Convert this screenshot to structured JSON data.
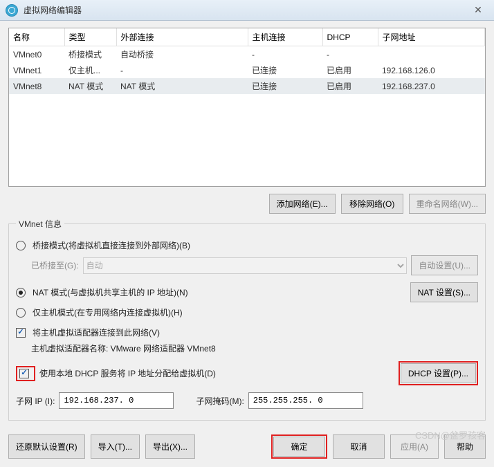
{
  "window": {
    "title": "虚拟网络编辑器",
    "close": "✕"
  },
  "table": {
    "headers": [
      "名称",
      "类型",
      "外部连接",
      "主机连接",
      "DHCP",
      "子网地址"
    ],
    "rows": [
      {
        "name": "VMnet0",
        "type": "桥接模式",
        "ext": "自动桥接",
        "host": "-",
        "dhcp": "-",
        "subnet": ""
      },
      {
        "name": "VMnet1",
        "type": "仅主机...",
        "ext": "-",
        "host": "已连接",
        "dhcp": "已启用",
        "subnet": "192.168.126.0"
      },
      {
        "name": "VMnet8",
        "type": "NAT 模式",
        "ext": "NAT 模式",
        "host": "已连接",
        "dhcp": "已启用",
        "subnet": "192.168.237.0"
      }
    ]
  },
  "buttons": {
    "add": "添加网络(E)...",
    "remove": "移除网络(O)",
    "rename": "重命名网络(W)...",
    "autoset": "自动设置(U)...",
    "natset": "NAT 设置(S)...",
    "dhcpset": "DHCP 设置(P)...",
    "restore": "还原默认设置(R)",
    "import": "导入(T)...",
    "export": "导出(X)...",
    "ok": "确定",
    "cancel": "取消",
    "apply": "应用(A)",
    "help": "帮助"
  },
  "info": {
    "legend": "VMnet 信息",
    "bridge": "桥接模式(将虚拟机直接连接到外部网络)(B)",
    "bridgedLabel": "已桥接至(G):",
    "bridgedValue": "自动",
    "nat": "NAT 模式(与虚拟机共享主机的 IP 地址)(N)",
    "hostonly": "仅主机模式(在专用网络内连接虚拟机)(H)",
    "connectAdapter": "将主机虚拟适配器连接到此网络(V)",
    "adapterName": "主机虚拟适配器名称: VMware 网络适配器 VMnet8",
    "dhcp": "使用本地 DHCP 服务将 IP 地址分配给虚拟机(D)",
    "subnetIpLabel": "子网 IP (I):",
    "subnetIp": "192.168.237. 0",
    "subnetMaskLabel": "子网掩码(M):",
    "subnetMask": "255.255.255. 0"
  },
  "watermark": "CSDN@盆罗孩客"
}
